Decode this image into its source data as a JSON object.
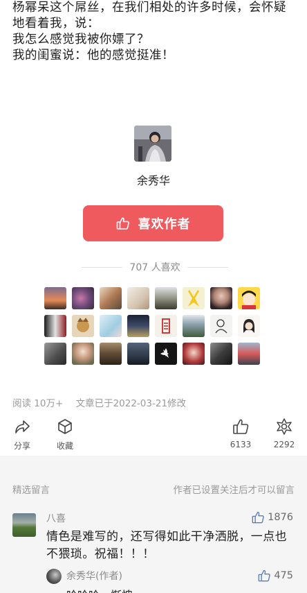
{
  "article": {
    "lines": [
      "杨幂呆这个屌丝，在我们相处的许多时候，会怀疑",
      "地看着我，说：",
      "我怎么感觉我被你嫖了？",
      "我的闺蜜说：他的感觉挺准！"
    ]
  },
  "author": {
    "name": "余秀华",
    "like_button_label": "喜欢作者"
  },
  "likes": {
    "count_text": "707 人喜欢"
  },
  "meta": {
    "reads": "阅读 10万+",
    "edited": "文章已于2022-03-21修改"
  },
  "actions": {
    "share_label": "分享",
    "favorite_label": "收藏",
    "like_count": "6133",
    "wow_count": "2292"
  },
  "comments": {
    "header_left": "精选留言",
    "header_right": "作者已设置关注后才可以留言",
    "items": [
      {
        "name": "八喜",
        "likes": "1876",
        "body": "情色是难写的，还写得如此干净洒脱，一点也不猥琐。祝福！！！"
      }
    ],
    "reply": {
      "name": "余秀华(作者)",
      "likes": "475",
      "body": "哈哈哈，惭愧"
    }
  },
  "colors": {
    "accent": "#ee5a5d",
    "comments_bg": "#f5f5f5",
    "muted_text": "#9a9a9a"
  }
}
